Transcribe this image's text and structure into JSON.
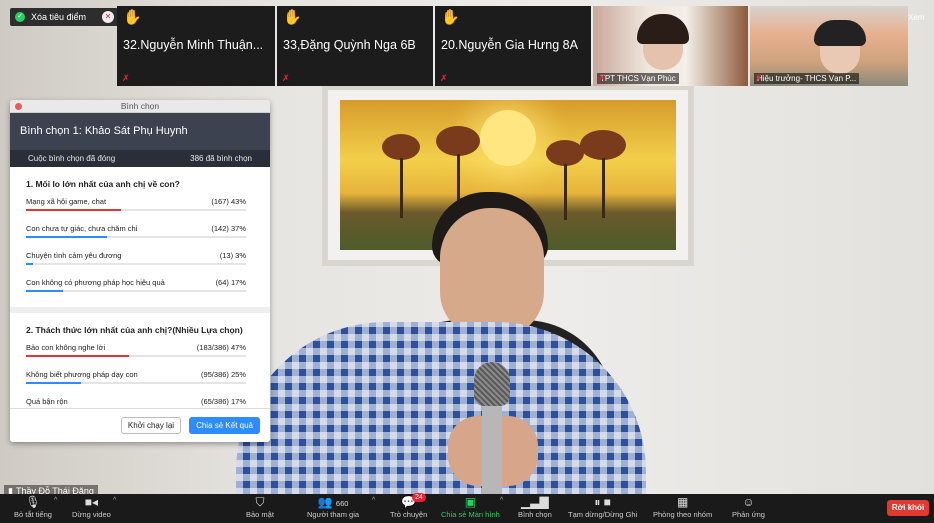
{
  "spotlight": {
    "remove_label": "Xóa tiêu điểm"
  },
  "tiles": [
    {
      "name": "32.Nguyễn Minh Thuận..."
    },
    {
      "name": "33,Đặng Quỳnh Nga 6B"
    },
    {
      "name": "20.Nguyễn Gia Hưng 8A"
    }
  ],
  "video_tiles": [
    {
      "label": "TPT THCS Vạn Phúc"
    },
    {
      "label": "Hiệu trưởng- THCS Vạn P..."
    }
  ],
  "view_label": "Xem",
  "speaker": {
    "name": "Thầy Đỗ Thái Đăng"
  },
  "poll": {
    "window_title": "Bình chọn",
    "title": "Bình chọn 1: Khảo Sát Phụ Huynh",
    "status": "Cuộc bình chọn đã đóng",
    "voted": "386 đã bình chọn",
    "questions": [
      {
        "title": "1. Mối lo lớn nhất của anh chị về con?",
        "options": [
          {
            "label": "Mạng xã hội game, chat",
            "count": "(167) 43%",
            "percent": 43,
            "color": "#e0392f"
          },
          {
            "label": "Con chưa tự giác, chưa chăm chỉ",
            "count": "(142) 37%",
            "percent": 37,
            "color": "#2d8cff"
          },
          {
            "label": "Chuyện tình cảm yêu đương",
            "count": "(13) 3%",
            "percent": 3,
            "color": "#2d8cff"
          },
          {
            "label": "Con không có phương pháp học hiệu quả",
            "count": "(64) 17%",
            "percent": 17,
            "color": "#2d8cff"
          }
        ]
      },
      {
        "title": "2. Thách thức lớn nhất của anh chị?(Nhiều Lựa chọn)",
        "options": [
          {
            "label": "Bảo con không nghe lời",
            "count": "(183/386) 47%",
            "percent": 47,
            "color": "#e0392f"
          },
          {
            "label": "Không biết phương pháp dạy con",
            "count": "(95/386) 25%",
            "percent": 25,
            "color": "#2d8cff"
          },
          {
            "label": "Quá bận rộn",
            "count": "(65/386) 17%",
            "percent": 17,
            "color": "#2d8cff"
          }
        ]
      }
    ],
    "restart_label": "Khởi chạy lại",
    "share_label": "Chia sẻ Kết quả"
  },
  "toolbar": {
    "mute": "Bỏ tắt tiếng",
    "stop_video": "Dừng video",
    "security": "Bảo mật",
    "participants": "Người tham gia",
    "participants_count": "660",
    "chat": "Trò chuyện",
    "chat_badge": "24",
    "share_screen": "Chia sẻ Màn hình",
    "polls": "Bình chọn",
    "pause_record": "Tạm dừng/Dừng Ghi",
    "breakout": "Phòng theo nhóm",
    "reactions": "Phản ứng",
    "leave": "Rời khỏi"
  }
}
